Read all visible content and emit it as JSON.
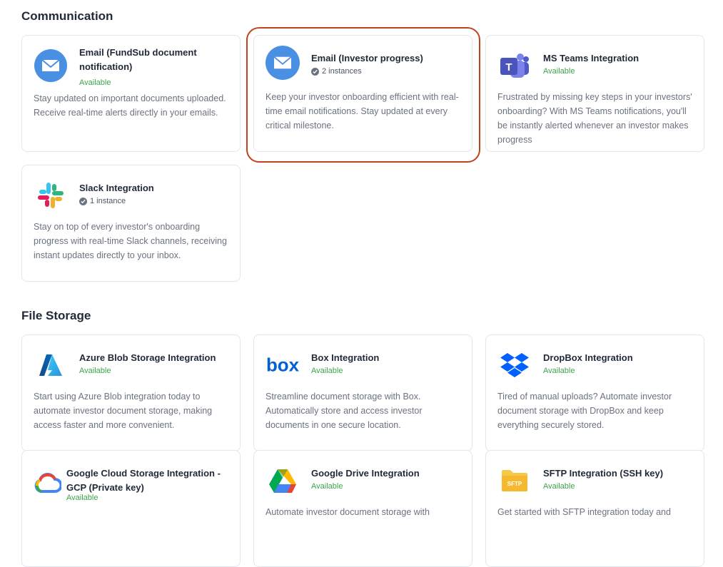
{
  "sections": {
    "communication": {
      "title": "Communication",
      "cards": [
        {
          "name": "Email (FundSub document notification)",
          "status": "Available",
          "icon": "email-icon",
          "description": "Stay updated on important documents uploaded. Receive real-time alerts directly in your emails."
        },
        {
          "name": "Email (Investor progress)",
          "instances": "2 instances",
          "icon": "email-icon",
          "description": "Keep your investor onboarding efficient with real-time email notifications. Stay updated at every critical milestone."
        },
        {
          "name": "MS Teams Integration",
          "status": "Available",
          "icon": "ms-teams-icon",
          "description": "Frustrated by missing key steps in your investors' onboarding? With MS Teams notifications, you'll be instantly alerted whenever an investor makes progress"
        },
        {
          "name": "Slack Integration",
          "instances": "1 instance",
          "icon": "slack-icon",
          "description": "Stay on top of every investor's onboarding progress with real-time Slack channels, receiving instant updates directly to your inbox."
        }
      ]
    },
    "file_storage": {
      "title": "File Storage",
      "cards": [
        {
          "name": "Azure Blob Storage Integration",
          "status": "Available",
          "icon": "azure-icon",
          "description": "Start using Azure Blob integration today to automate investor document storage, making access faster and more convenient."
        },
        {
          "name": "Box Integration",
          "status": "Available",
          "icon": "box-icon",
          "description": "Streamline document storage with Box. Automatically store and access investor documents in one secure location."
        },
        {
          "name": "DropBox Integration",
          "status": "Available",
          "icon": "dropbox-icon",
          "description": "Tired of manual uploads? Automate investor document storage with DropBox and keep everything securely stored."
        },
        {
          "name": "Google Cloud Storage Integration - GCP (Private key)",
          "status": "Available",
          "icon": "google-cloud-icon",
          "description": ""
        },
        {
          "name": "Google Drive Integration",
          "status": "Available",
          "icon": "google-drive-icon",
          "description": "Automate investor document storage with"
        },
        {
          "name": "SFTP Integration (SSH key)",
          "status": "Available",
          "icon": "sftp-folder-icon",
          "icon_label": "SFTP",
          "description": "Get started with SFTP integration today and"
        }
      ]
    }
  },
  "colors": {
    "available": "#3aa54a",
    "highlight": "#c2411f",
    "email_blue": "#4a90e2",
    "teams": "#5059c9"
  }
}
